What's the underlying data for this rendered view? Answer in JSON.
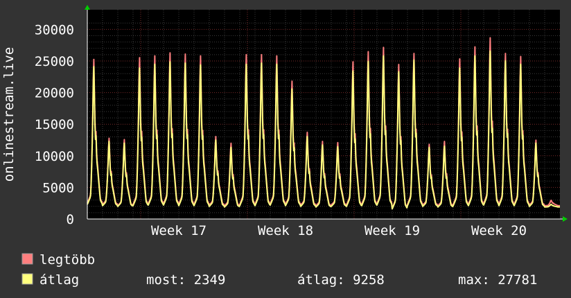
{
  "colors": {
    "background": "#333333",
    "canvas": "#000000",
    "grid_minor": "#3a3a3a",
    "grid_major": "#7a2a2a",
    "axis": "#ffffff",
    "axis_arrow": "#00cc00",
    "max_series": "#ff7f7f",
    "avg_series": "#ffff7f"
  },
  "legend": {
    "max_label": "legtöbb",
    "avg_label": "átlag",
    "current_text": "most: 2349",
    "average_text": "átlag: 9258",
    "max_text": "max: 27781"
  },
  "chart_data": {
    "type": "line",
    "ylabel": "onlinestream.live",
    "ylim": [
      0,
      31000
    ],
    "yticks": [
      0,
      5000,
      10000,
      15000,
      20000,
      25000,
      30000
    ],
    "x_ticks": [
      "Week 17",
      "Week 18",
      "Week 19",
      "Week 20"
    ],
    "grid": true,
    "days": 31,
    "series": [
      {
        "name": "legtöbb",
        "color": "#ff7f7f",
        "daily_peaks": [
          26400,
          13300,
          13100,
          26700,
          27000,
          27500,
          27300,
          27000,
          13600,
          12500,
          27200,
          27200,
          27000,
          22800,
          14300,
          12800,
          12600,
          26000,
          27700,
          28400,
          25600,
          27400,
          12300,
          12800,
          26500,
          28500,
          30000,
          27400,
          26900,
          13000,
          3000
        ],
        "daily_mins": [
          2500,
          2300,
          2100,
          2300,
          2400,
          2400,
          2300,
          2300,
          2200,
          2100,
          2300,
          2300,
          2400,
          2300,
          2200,
          2100,
          2200,
          2200,
          2300,
          2400,
          1700,
          2300,
          2200,
          2100,
          2300,
          2300,
          2400,
          2300,
          2300,
          2200,
          2100
        ]
      },
      {
        "name": "átlag",
        "color": "#ffff7f",
        "daily_peaks": [
          25200,
          12800,
          12500,
          25000,
          25600,
          26000,
          25800,
          25500,
          13000,
          11800,
          25600,
          25800,
          25600,
          21500,
          13600,
          12200,
          11900,
          24500,
          26100,
          27000,
          24400,
          26300,
          11800,
          12000,
          25000,
          27000,
          27800,
          26200,
          25600,
          12500,
          2349
        ],
        "daily_mins": [
          2300,
          2100,
          2000,
          2100,
          2200,
          2200,
          2100,
          2100,
          2000,
          1900,
          2100,
          2100,
          2200,
          2100,
          2000,
          1900,
          2000,
          2000,
          2100,
          2200,
          1600,
          2100,
          2000,
          1900,
          2100,
          2100,
          2200,
          2100,
          2100,
          2000,
          1900
        ]
      }
    ]
  }
}
